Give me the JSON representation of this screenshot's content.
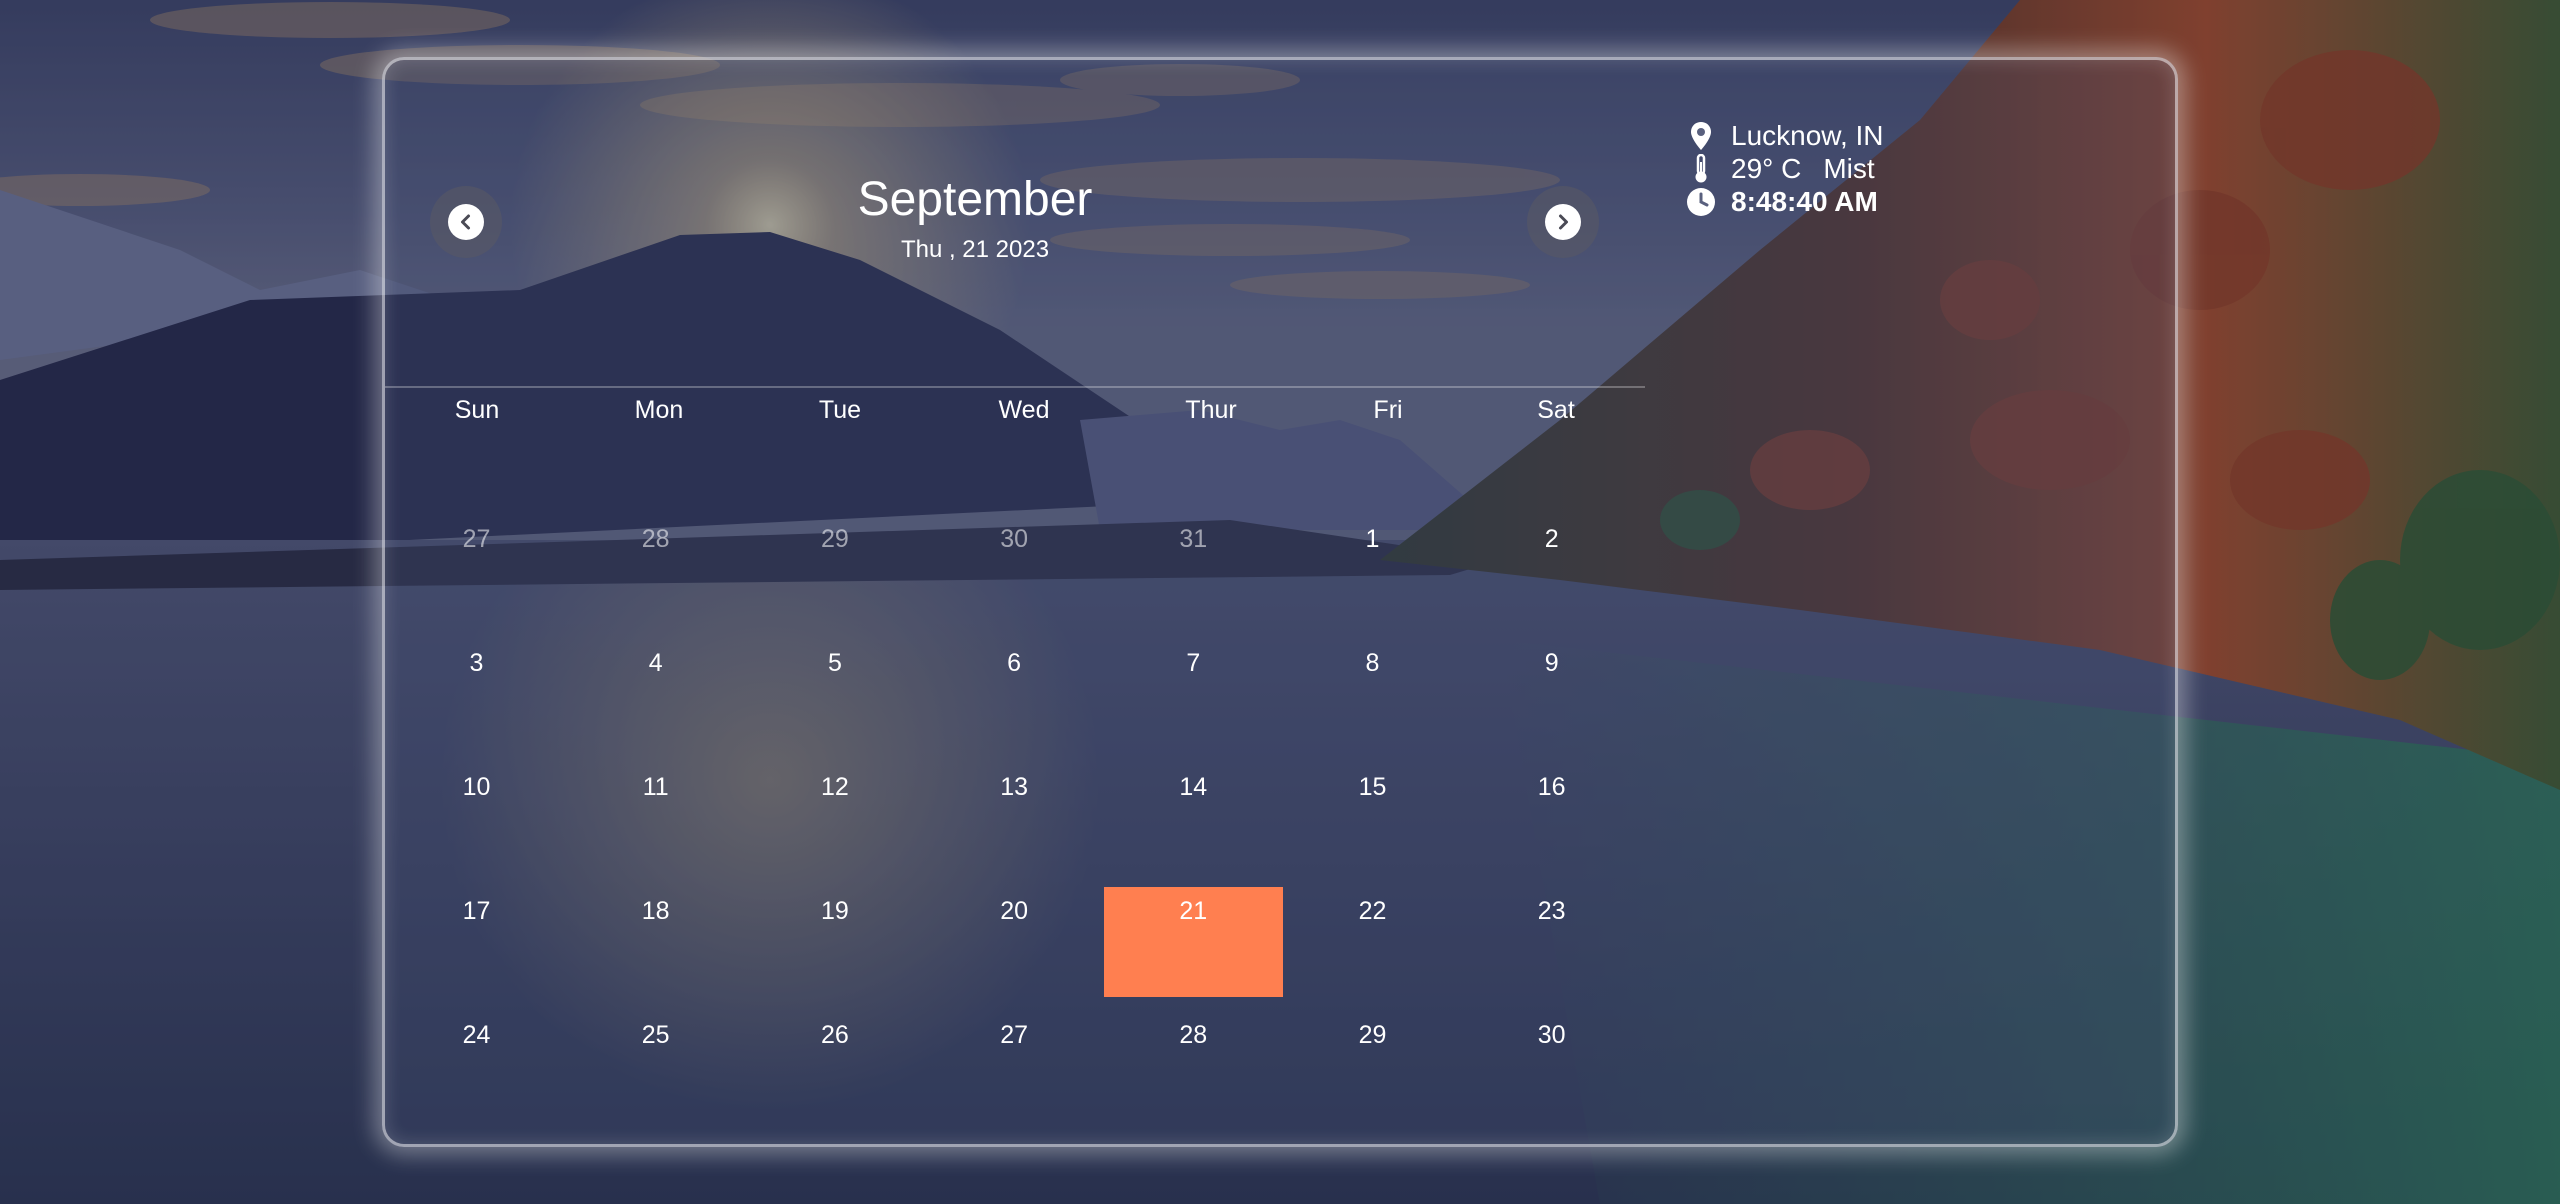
{
  "calendar": {
    "month": "September",
    "subtitle": "Thu , 21 2023",
    "prev_icon": "chevron-left-icon",
    "next_icon": "chevron-right-icon",
    "weekdays": [
      "Sun",
      "Mon",
      "Tue",
      "Wed",
      "Thur",
      "Fri",
      "Sat"
    ],
    "weeks": [
      [
        {
          "d": "27",
          "m": true
        },
        {
          "d": "28",
          "m": true
        },
        {
          "d": "29",
          "m": true
        },
        {
          "d": "30",
          "m": true
        },
        {
          "d": "31",
          "m": true
        },
        {
          "d": "1"
        },
        {
          "d": "2"
        }
      ],
      [
        {
          "d": "3"
        },
        {
          "d": "4"
        },
        {
          "d": "5"
        },
        {
          "d": "6"
        },
        {
          "d": "7"
        },
        {
          "d": "8"
        },
        {
          "d": "9"
        }
      ],
      [
        {
          "d": "10"
        },
        {
          "d": "11"
        },
        {
          "d": "12"
        },
        {
          "d": "13"
        },
        {
          "d": "14"
        },
        {
          "d": "15"
        },
        {
          "d": "16"
        }
      ],
      [
        {
          "d": "17"
        },
        {
          "d": "18"
        },
        {
          "d": "19"
        },
        {
          "d": "20"
        },
        {
          "d": "21",
          "today": true
        },
        {
          "d": "22"
        },
        {
          "d": "23"
        }
      ],
      [
        {
          "d": "24"
        },
        {
          "d": "25"
        },
        {
          "d": "26"
        },
        {
          "d": "27"
        },
        {
          "d": "28"
        },
        {
          "d": "29"
        },
        {
          "d": "30"
        }
      ]
    ],
    "today_color": "#ff7f50"
  },
  "info": {
    "location": "Lucknow, IN",
    "temperature": "29° C",
    "condition": "Mist",
    "time": "8:48:40 AM",
    "location_icon": "map-pin-icon",
    "temperature_icon": "thermometer-icon",
    "time_icon": "clock-icon"
  }
}
